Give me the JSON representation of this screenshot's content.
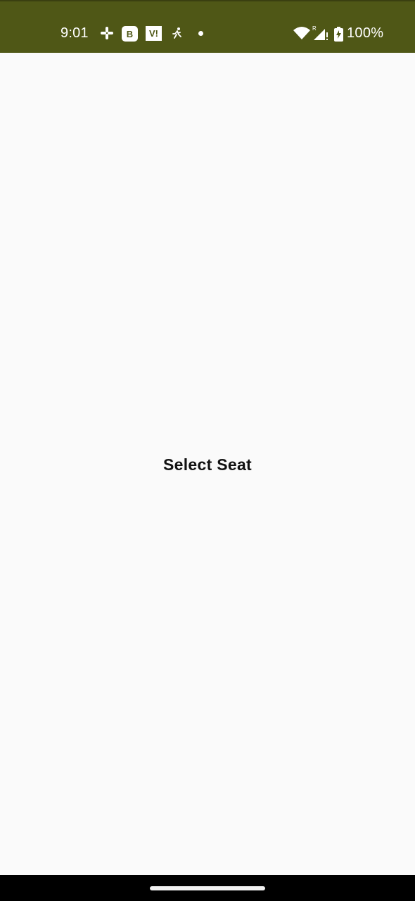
{
  "status_bar": {
    "time": "9:01",
    "battery_text": "100%",
    "background_color": "#4f5716",
    "icons": [
      "slack-icon",
      "b-app-icon",
      "vi-app-icon",
      "running-icon",
      "notification-dot-icon",
      "wifi-icon",
      "signal-icon",
      "battery-icon"
    ],
    "b_icon_label": "B",
    "vi_icon_label": "V!"
  },
  "main": {
    "title": "Select Seat"
  },
  "nav_bar": {
    "home_indicator": "home-indicator"
  }
}
